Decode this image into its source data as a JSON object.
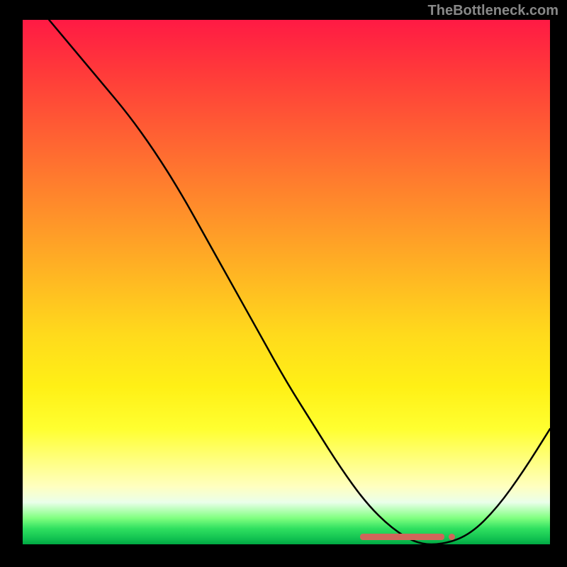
{
  "watermark": "TheBottleneck.com",
  "chart_data": {
    "type": "line",
    "title": "",
    "xlabel": "",
    "ylabel": "",
    "xlim": [
      0,
      100
    ],
    "ylim": [
      0,
      100
    ],
    "series": [
      {
        "name": "curve",
        "x": [
          5,
          10,
          15,
          20,
          25,
          30,
          35,
          40,
          45,
          50,
          55,
          60,
          65,
          70,
          75,
          80,
          85,
          90,
          95,
          100
        ],
        "y": [
          100,
          94,
          88,
          82,
          75,
          67,
          58,
          49,
          40,
          31,
          23,
          15,
          8,
          3,
          0,
          0,
          2,
          7,
          14,
          22
        ]
      }
    ],
    "marker": {
      "x_start": 64,
      "x_end": 80,
      "y": 1.5,
      "label": ""
    },
    "background_gradient": {
      "top": "#ff1a44",
      "mid": "#ffff30",
      "bottom": "#00a843"
    }
  }
}
